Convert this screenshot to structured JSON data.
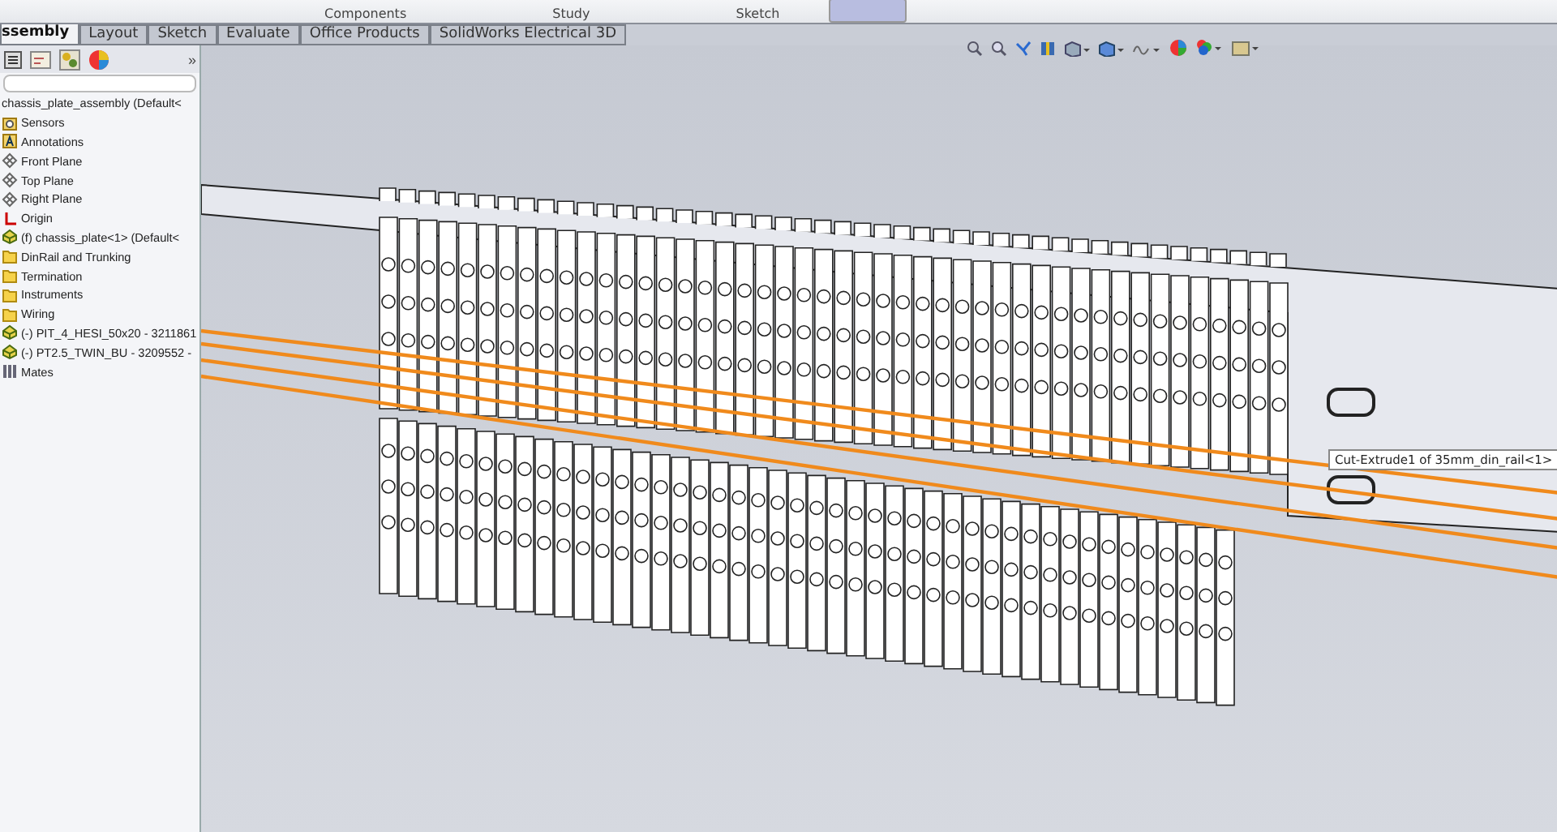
{
  "ribbon": {
    "labels": [
      "Components",
      "Study",
      "Sketch"
    ]
  },
  "tabs": [
    {
      "label": "ssembly",
      "selected": true
    },
    {
      "label": "Layout",
      "selected": false
    },
    {
      "label": "Sketch",
      "selected": false
    },
    {
      "label": "Evaluate",
      "selected": false
    },
    {
      "label": "Office Products",
      "selected": false
    },
    {
      "label": "SolidWorks Electrical 3D",
      "selected": false
    }
  ],
  "panel": {
    "expand": "»",
    "tree": [
      {
        "label": "chassis_plate_assembly  (Default<",
        "kind": "root"
      },
      {
        "label": "Sensors",
        "kind": "sensor"
      },
      {
        "label": "Annotations",
        "kind": "annotation"
      },
      {
        "label": "Front Plane",
        "kind": "plane"
      },
      {
        "label": "Top Plane",
        "kind": "plane"
      },
      {
        "label": "Right Plane",
        "kind": "plane"
      },
      {
        "label": "Origin",
        "kind": "origin"
      },
      {
        "label": "(f) chassis_plate<1> (Default<",
        "kind": "part"
      },
      {
        "label": "DinRail and Trunking",
        "kind": "folder"
      },
      {
        "label": "Termination",
        "kind": "folder"
      },
      {
        "label": "Instruments",
        "kind": "folder"
      },
      {
        "label": "Wiring",
        "kind": "folder"
      },
      {
        "label": "(-) PIT_4_HESI_50x20 - 3211861",
        "kind": "part"
      },
      {
        "label": "(-) PT2.5_TWIN_BU - 3209552 -",
        "kind": "part"
      },
      {
        "label": "Mates",
        "kind": "mates"
      }
    ]
  },
  "viewport": {
    "tooltip": "Cut-Extrude1 of 35mm_din_rail<1>"
  }
}
